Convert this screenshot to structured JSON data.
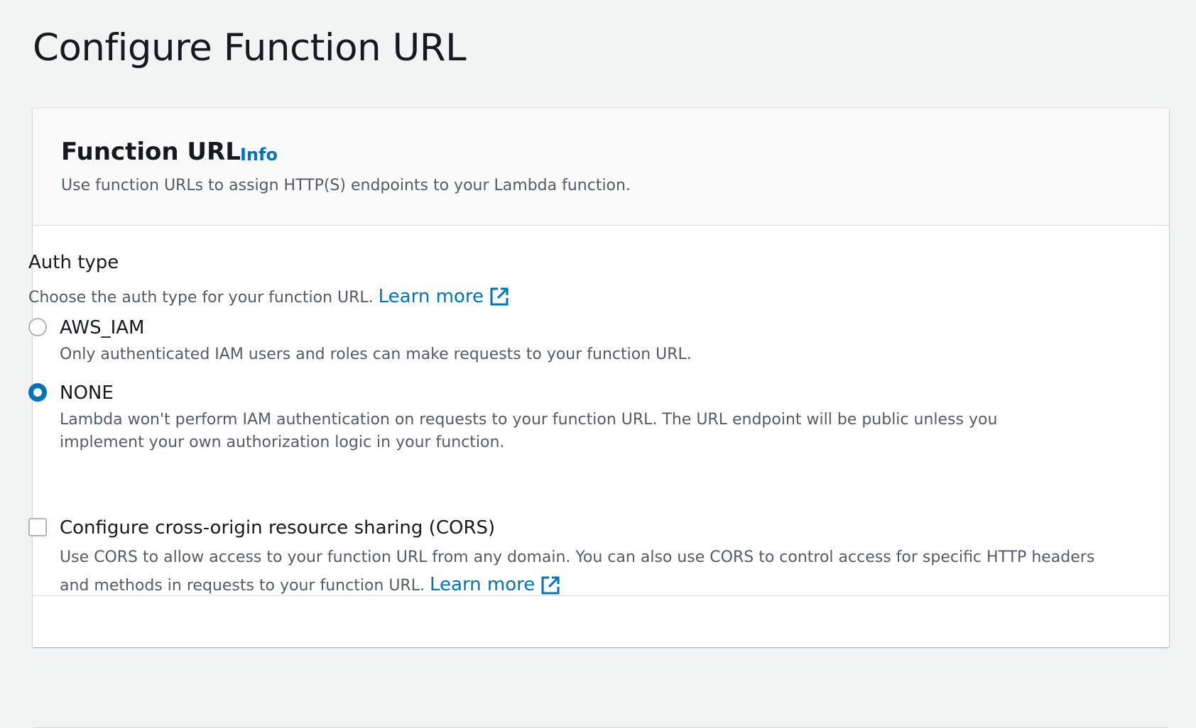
{
  "page": {
    "title": "Configure Function URL"
  },
  "panel": {
    "title": "Function URL",
    "info_label": "Info",
    "description": "Use function URLs to assign HTTP(S) endpoints to your Lambda function."
  },
  "auth_type": {
    "label": "Auth type",
    "description": "Choose the auth type for your function URL.",
    "learn_more": "Learn more",
    "selected": "NONE",
    "options": [
      {
        "label": "AWS_IAM",
        "description": "Only authenticated IAM users and roles can make requests to your function URL.",
        "checked": false
      },
      {
        "label": "NONE",
        "description": "Lambda won't perform IAM authentication on requests to your function URL. The URL endpoint will be public unless you implement your own authorization logic in your function.",
        "checked": true
      }
    ]
  },
  "cors": {
    "label": "Configure cross-origin resource sharing (CORS)",
    "description": "Use CORS to allow access to your function URL from any domain. You can also use CORS to control access for specific HTTP headers and methods in requests to your function URL.",
    "learn_more": "Learn more",
    "checked": false
  },
  "colors": {
    "link": "#0073bb",
    "radio_selected": "#0073bb",
    "page_background": "#f2f3f3",
    "panel_header_background": "#fafafa"
  },
  "icons": {
    "external_link": "external-link-icon"
  }
}
